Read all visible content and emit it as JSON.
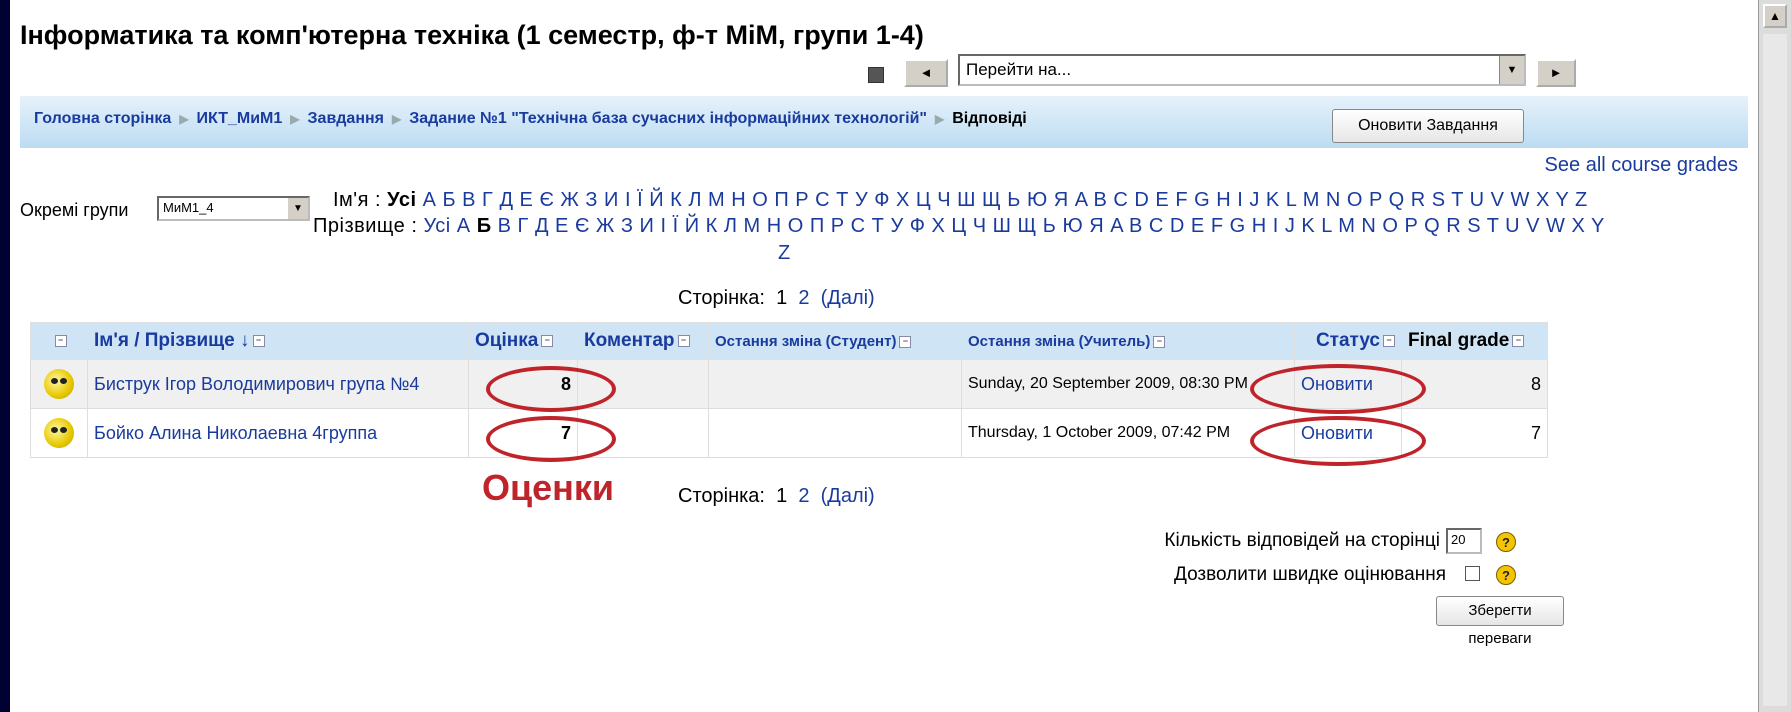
{
  "page": {
    "title": "Інформатика та комп'ютерна техніка (1 семестр, ф-т МіМ, групи 1-4)",
    "jump_select": "Перейти на..."
  },
  "breadcrumb": {
    "items": [
      "Головна сторінка",
      "ИКТ_МиМ1",
      "Завдання",
      "Задание №1 \"Технічна база сучасних інформаційних технологій\""
    ],
    "current": "Відповіді",
    "update_button": "Оновити Завдання"
  },
  "see_all": "See all course grades",
  "groups": {
    "label": "Окремі групи",
    "selected": "МиМ1_4"
  },
  "filters": {
    "first_name_label": "Ім'я :",
    "first_name_all": "Усі",
    "first_name_letters": "А Б В Г Д Е Є Ж З И І Ї Й К Л М Н О П Р С Т У Ф Х Ц Ч Ш Щ Ь Ю Я A B C D E F G H I J K L M N O P Q R S T U V W X Y Z",
    "last_name_label": "Прізвище :",
    "last_name_all": "Усі А",
    "last_name_selected": "Б",
    "last_name_letters": "В Г Д Е Є Ж З И І Ї Й К Л М Н О П Р С Т У Ф Х Ц Ч Ш Щ Ь Ю Я A B C D E F G H I J K L M N O P Q R S T U V W X Y",
    "last_name_wrap": "Z"
  },
  "paging": {
    "label": "Сторінка:",
    "p1": "1",
    "p2": "2",
    "next": "(Далі)"
  },
  "table": {
    "headers": [
      "Ім'я / Прізвище",
      "Оцінка",
      "Коментар",
      "Остання зміна (Студент)",
      "Остання зміна (Учитель)",
      "Статус",
      "Final grade"
    ],
    "sort_arrow": "↓",
    "rows": [
      {
        "name": "Биструк Ігор Володимирович група №4",
        "grade": "8",
        "comment": "",
        "student_changed": "",
        "teacher_changed": "Sunday, 20 September 2009, 08:30 PM",
        "status": "Оновити",
        "final": "8"
      },
      {
        "name": "Бойко Алина Николаевна 4группа",
        "grade": "7",
        "comment": "",
        "student_changed": "",
        "teacher_changed": "Thursday, 1 October 2009, 07:42 PM",
        "status": "Оновити",
        "final": "7"
      }
    ]
  },
  "annotation": "Оценки",
  "options": {
    "per_page_label": "Кількість відповідей на сторінці",
    "per_page_value": "20",
    "quick_grade_label": "Дозволити швидке оцінювання",
    "save_button": "Зберегти переваги"
  },
  "colors": {
    "link": "#1a3b9e",
    "annotation": "#c0242b",
    "navbar": "#bcdcf2"
  }
}
